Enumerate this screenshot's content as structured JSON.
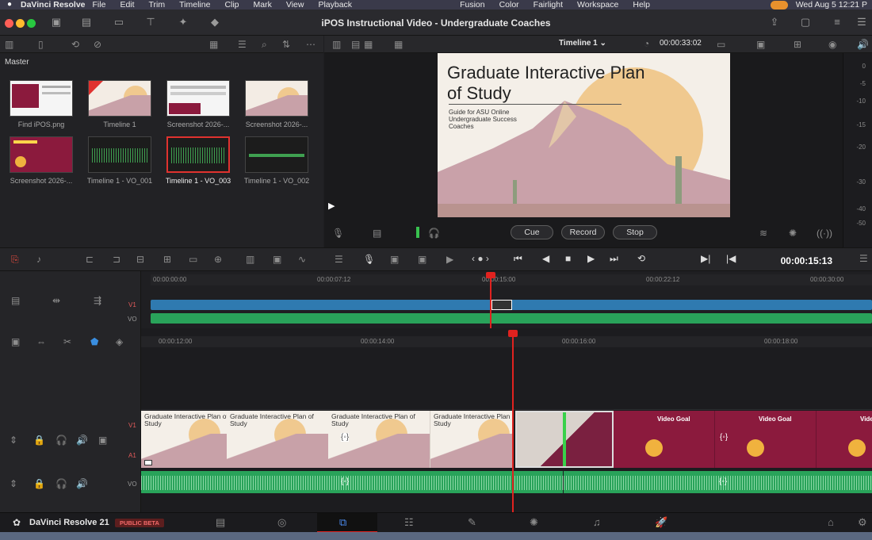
{
  "menubar": {
    "app": "DaVinci Resolve",
    "items": [
      "File",
      "Edit",
      "Trim",
      "Timeline",
      "Clip",
      "Mark",
      "View",
      "Playback",
      "Fusion",
      "Color",
      "Fairlight",
      "Workspace",
      "Help"
    ],
    "clock": "Wed Aug 5  12:21 P"
  },
  "window": {
    "title": "iPOS Instructional Video - Undergraduate Coaches"
  },
  "viewer": {
    "timeline_name": "Timeline 1",
    "timecode": "00:00:33:02",
    "slide_title": "Graduate Interactive Plan of Study",
    "slide_subtitle": "Guide for ASU Online Undergraduate Success Coaches",
    "buttons": {
      "cue": "Cue",
      "record": "Record",
      "stop": "Stop"
    },
    "meter_labels": [
      "0",
      "-5",
      "-10",
      "-15",
      "-20",
      "-30",
      "-40",
      "-50"
    ]
  },
  "media_pool": {
    "bin": "Master",
    "clips": [
      {
        "label": "Find iPOS.png",
        "kind": "image"
      },
      {
        "label": "Timeline 1",
        "kind": "timeline"
      },
      {
        "label": "Screenshot 2026-...",
        "kind": "image"
      },
      {
        "label": "Screenshot 2026-...",
        "kind": "image"
      },
      {
        "label": "Screenshot 2026-...",
        "kind": "image"
      },
      {
        "label": "Timeline 1 - VO_001",
        "kind": "audio"
      },
      {
        "label": "Timeline 1 - VO_003",
        "kind": "audio",
        "selected": true
      },
      {
        "label": "Timeline 1 - VO_002",
        "kind": "audio"
      }
    ]
  },
  "transport": {
    "timecode": "00:00:15:13"
  },
  "upper_timeline": {
    "ticks": [
      "00:00:00:00",
      "00:00:07:12",
      "00:00:15:00",
      "00:00:22:12",
      "00:00:30:00"
    ],
    "tracks": [
      "V1",
      "VO"
    ]
  },
  "lower_timeline": {
    "ticks": [
      "00:00:12:00",
      "00:00:14:00",
      "00:00:16:00",
      "00:00:18:00"
    ],
    "tracks": [
      "V1",
      "A1",
      "VO"
    ],
    "slide_tile_text": "Graduate Interactive Plan of Study",
    "video_goal_text": "Video Goal"
  },
  "footer": {
    "app": "DaVinci Resolve 21",
    "badge": "PUBLIC BETA"
  },
  "colors": {
    "accent_red": "#e0221f",
    "audio_green": "#29a35a",
    "clip_blue": "#2f7ab0",
    "maroon": "#8b1a3d"
  }
}
